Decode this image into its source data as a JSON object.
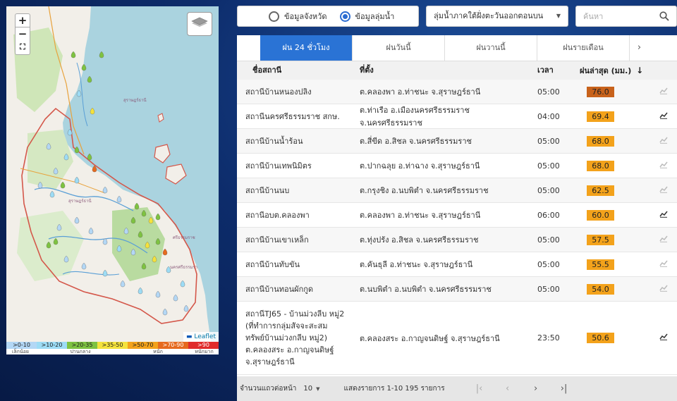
{
  "map": {
    "zoom_in": "+",
    "zoom_out": "−",
    "attribution": "Leaflet",
    "labels": [
      "สุราษฎร์ธานี",
      "ศรีธรรมราช",
      "นครศรีธรรมรา",
      "สุราษฎร์ธานี"
    ],
    "legend": [
      {
        "label": ">0-10",
        "color": "#b3d7f5"
      },
      {
        "label": ">10-20",
        "color": "#9ddcf5"
      },
      {
        "label": ">20-35",
        "color": "#7ec241"
      },
      {
        "label": ">35-50",
        "color": "#f4e23c"
      },
      {
        "label": ">50-70",
        "color": "#f3a21b"
      },
      {
        "label": ">70-90",
        "color": "#e66a1f"
      },
      {
        "label": ">90",
        "color": "#e02b2b"
      }
    ],
    "legend_names": [
      "เล็กน้อย",
      "ปานกลาง",
      "หนัก",
      "หนักมาก"
    ]
  },
  "filter": {
    "radio_province": "ข้อมูลจังหวัด",
    "radio_basin": "ข้อมูลลุ่มน้ำ",
    "selected": "basin",
    "basin_select": "ลุ่มน้ำภาคใต้ฝั่งตะวันออกตอนบน",
    "search_placeholder": "ค้นหา"
  },
  "tabs": [
    "ฝน 24 ชั่วโมง",
    "ฝนวันนี้",
    "ฝนวานนี้",
    "ฝนรายเดือน"
  ],
  "table": {
    "headers": {
      "name": "ชื่อสถานี",
      "location": "ที่ตั้ง",
      "time": "เวลา",
      "rain": "ฝนล่าสุด (มม.)"
    },
    "rows": [
      {
        "name": "สถานีบ้านหนองปลิง",
        "location": "ต.คลองพา อ.ท่าชนะ จ.สุราษฎร์ธานี",
        "time": "05:00",
        "rain": "76.0",
        "color": "#c8621b",
        "trend_dark": false
      },
      {
        "name": "สถานีนครศรีธรรมราช สกษ.",
        "location": "ต.ท่าเรือ อ.เมืองนครศรีธรรมราช จ.นครศรีธรรมราช",
        "time": "04:00",
        "rain": "69.4",
        "color": "#f3a21b",
        "trend_dark": true
      },
      {
        "name": "สถานีบ้านน้ำร้อน",
        "location": "ต.สี่ขีด อ.สิชล จ.นครศรีธรรมราช",
        "time": "05:00",
        "rain": "68.0",
        "color": "#f3a21b",
        "trend_dark": false
      },
      {
        "name": "สถานีบ้านเทพนิมิตร",
        "location": "ต.ปากฉลุย อ.ท่าฉาง จ.สุราษฎร์ธานี",
        "time": "05:00",
        "rain": "68.0",
        "color": "#f3a21b",
        "trend_dark": false
      },
      {
        "name": "สถานีบ้านนบ",
        "location": "ต.กรุงชิง อ.นบพิตำ จ.นครศรีธรรมราช",
        "time": "05:00",
        "rain": "62.5",
        "color": "#f3a21b",
        "trend_dark": false
      },
      {
        "name": "สถานีอบต.คลองพา",
        "location": "ต.คลองพา อ.ท่าชนะ จ.สุราษฎร์ธานี",
        "time": "06:00",
        "rain": "60.0",
        "color": "#f3a21b",
        "trend_dark": true
      },
      {
        "name": "สถานีบ้านเขาเหล็ก",
        "location": "ต.ทุ่งปรัง อ.สิชล จ.นครศรีธรรมราช",
        "time": "05:00",
        "rain": "57.5",
        "color": "#f3a21b",
        "trend_dark": false
      },
      {
        "name": "สถานีบ้านทับขัน",
        "location": "ต.คันธุลี อ.ท่าชนะ จ.สุราษฎร์ธานี",
        "time": "05:00",
        "rain": "55.5",
        "color": "#f3a21b",
        "trend_dark": false
      },
      {
        "name": "สถานีบ้านทอนผักกูด",
        "location": "ต.นบพิตำ อ.นบพิตำ จ.นครศรีธรรมราช",
        "time": "05:00",
        "rain": "54.0",
        "color": "#f3a21b",
        "trend_dark": false
      },
      {
        "name_lines": [
          "สถานีTJ65 - บ้านม่วงลีบ หมู่2",
          "(ที่ทำการกลุ่มสัจจะสะสม",
          "ทรัพย์บ้านม่วงกลีบ หมู่2)",
          "ต.คลองสระ อ.กาญจนดิษฐ์",
          "จ.สุราษฎร์ธานี"
        ],
        "location": "ต.คลองสระ อ.กาญจนดิษฐ์ จ.สุราษฎร์ธานี",
        "time": "23:50",
        "rain": "50.6",
        "color": "#f3a21b",
        "trend_dark": true
      }
    ]
  },
  "pagination": {
    "rows_per_page_label": "จำนวนแถวต่อหน้า",
    "rows_per_page": "10",
    "range": "แสดงรายการ 1-10 195 รายการ"
  }
}
